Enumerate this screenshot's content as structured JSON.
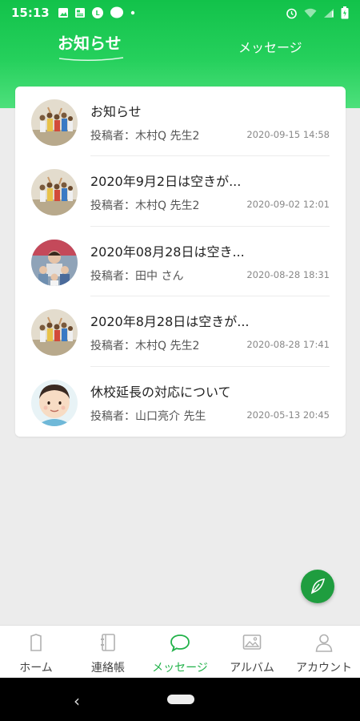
{
  "status_bar": {
    "time": "15:13",
    "left_icons": [
      "image-icon",
      "news-icon",
      "line-icon",
      "chat-bubble-icon",
      "dot-icon"
    ],
    "right_icons": [
      "alarm-icon",
      "wifi-icon",
      "signal-icon",
      "battery-icon"
    ]
  },
  "header": {
    "tabs": [
      {
        "label": "お知らせ",
        "active": true
      },
      {
        "label": "メッセージ",
        "active": false
      }
    ]
  },
  "notices": [
    {
      "title": "お知らせ",
      "author": "投稿者：木村Q 先生2",
      "date": "2020-09-15 14:58",
      "avatar": "group-photo"
    },
    {
      "title": "2020年9月2日は空きが...",
      "author": "投稿者：木村Q 先生2",
      "date": "2020-09-02 12:01",
      "avatar": "group-photo"
    },
    {
      "title": "2020年08月28日は空き...",
      "author": "投稿者：田中 さん",
      "date": "2020-08-28 18:31",
      "avatar": "family-photo"
    },
    {
      "title": "2020年8月28日は空きが...",
      "author": "投稿者：木村Q 先生2",
      "date": "2020-08-28 17:41",
      "avatar": "group-photo"
    },
    {
      "title": "休校延長の対応について",
      "author": "投稿者：山口亮介 先生",
      "date": "2020-05-13 20:45",
      "avatar": "face-illustration"
    }
  ],
  "fab": {
    "icon": "feather-pen-icon"
  },
  "bottom_nav": [
    {
      "label": "ホーム",
      "icon": "home-icon",
      "active": false
    },
    {
      "label": "連絡帳",
      "icon": "notebook-icon",
      "active": false
    },
    {
      "label": "メッセージ",
      "icon": "speech-bubble-icon",
      "active": true
    },
    {
      "label": "アルバム",
      "icon": "photo-album-icon",
      "active": false
    },
    {
      "label": "アカウント",
      "icon": "person-icon",
      "active": false
    }
  ],
  "system_nav": {
    "back": "‹"
  },
  "colors": {
    "header_green": "#22cc58",
    "accent_green": "#22b24a",
    "fab_green": "#1f9d3f",
    "background": "#ececec"
  }
}
